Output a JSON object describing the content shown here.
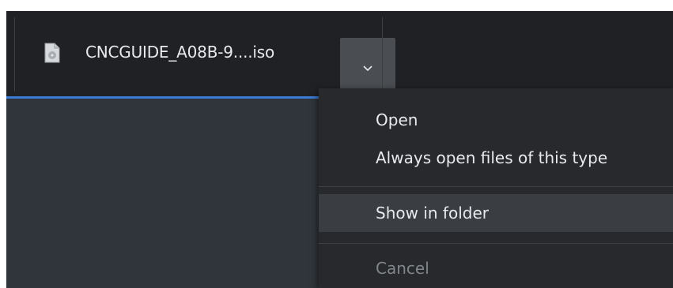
{
  "download_bar": {
    "file_name": "CNCGUIDE_A08B-9....iso",
    "file_icon": "disc-image-file-icon",
    "chevron_icon": "chevron-down-icon"
  },
  "context_menu": {
    "items": [
      {
        "label": "Open",
        "state": "normal"
      },
      {
        "label": "Always open files of this type",
        "state": "normal"
      },
      {
        "label": "Show in folder",
        "state": "highlighted"
      },
      {
        "label": "Cancel",
        "state": "disabled"
      }
    ]
  },
  "colors": {
    "bar_background": "#202124",
    "menu_background": "#27292c",
    "highlight": "#3a3d41",
    "accent": "#3a7bd5",
    "text": "#e8eaed",
    "disabled_text": "#80868b"
  }
}
